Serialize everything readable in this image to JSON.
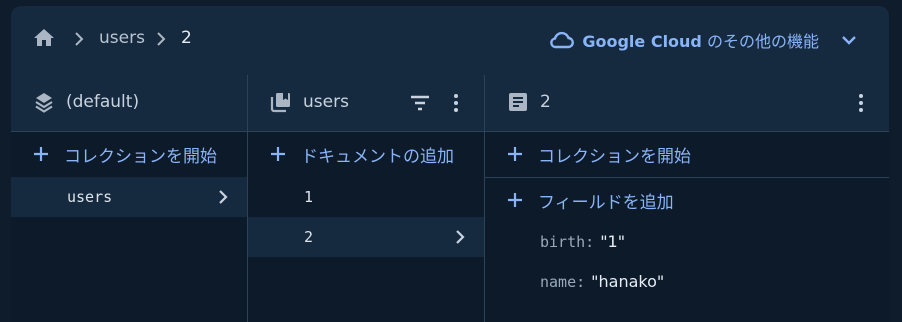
{
  "breadcrumb": {
    "items": [
      "users",
      "2"
    ]
  },
  "cloud": {
    "brand": "Google Cloud",
    "rest": "のその他の機能"
  },
  "columns": {
    "root": {
      "title": "(default)",
      "add_label": "コレクションを開始",
      "items": [
        "users"
      ]
    },
    "collection": {
      "title": "users",
      "add_label": "ドキュメントの追加",
      "items": [
        "1",
        "2"
      ]
    },
    "document": {
      "title": "2",
      "add_collection_label": "コレクションを開始",
      "add_field_label": "フィールドを追加",
      "fields": [
        {
          "key": "birth:",
          "value": "\"1\""
        },
        {
          "key": "name:",
          "value": "\"hanako\""
        }
      ]
    }
  },
  "colors": {
    "accent": "#8ab4f8",
    "panel_bg": "#0c1a2a",
    "header_bg": "#15293f"
  }
}
